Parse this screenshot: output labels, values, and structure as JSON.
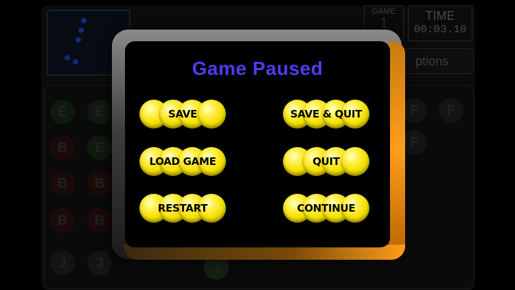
{
  "background": {
    "game_label": "GAME",
    "game_value": "1",
    "time_label": "TIME",
    "time_value": "00:03.10",
    "options_label": "ptions",
    "grid_letters": [
      "E",
      "E",
      "B",
      "E",
      "B",
      "B",
      "B",
      "B",
      "J",
      "J",
      "J",
      "F",
      "F",
      "F"
    ]
  },
  "dialog": {
    "title": "Game Paused",
    "buttons": {
      "save": "SAVE",
      "save_quit": "SAVE & QUIT",
      "load_game": "LOAD GAME",
      "quit": "QUIT",
      "restart": "RESTART",
      "continue": "CONTINUE"
    }
  },
  "colors": {
    "title": "#4d3df2",
    "orb_yellow": "#f5e000",
    "rim_orange": "#ff9d1c"
  }
}
